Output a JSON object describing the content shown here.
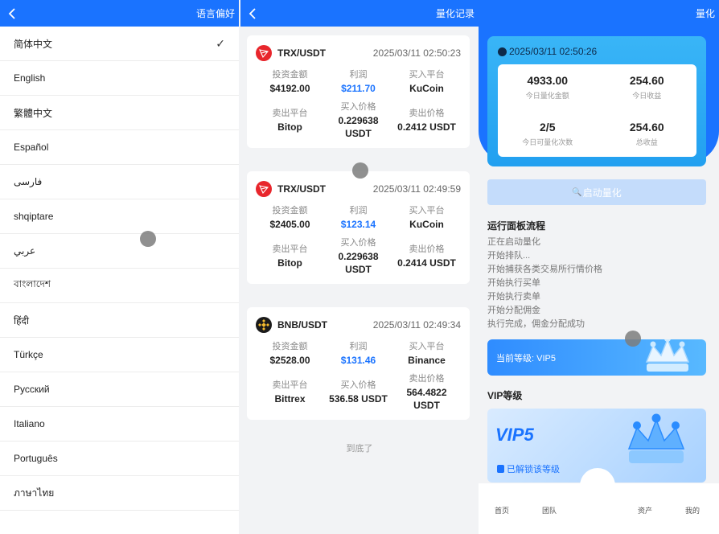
{
  "lang_panel": {
    "title": "语言偏好",
    "languages": [
      "简体中文",
      "English",
      "繁體中文",
      "Español",
      "فارسی",
      "shqiptare",
      "عربي",
      "বাংলাদেশ",
      "हिंदी",
      "Türkçe",
      "Русский",
      "Italiano",
      "Português",
      "ภาษาไทย"
    ],
    "selected_index": 0
  },
  "records_panel": {
    "title": "量化记录",
    "labels": {
      "invest": "投资金额",
      "profit": "利润",
      "buy_platform": "买入平台",
      "sell_platform": "卖出平台",
      "buy_price": "买入价格",
      "sell_price": "卖出价格"
    },
    "records": [
      {
        "coin_icon": "tron-icon",
        "pair": "TRX/USDT",
        "time": "2025/03/11 02:50:23",
        "invest": "$4192.00",
        "profit": "$211.70",
        "buy_platform": "KuCoin",
        "sell_platform": "Bitop",
        "buy_price": "0.229638 USDT",
        "sell_price": "0.2412 USDT"
      },
      {
        "coin_icon": "tron-icon",
        "pair": "TRX/USDT",
        "time": "2025/03/11 02:49:59",
        "invest": "$2405.00",
        "profit": "$123.14",
        "buy_platform": "KuCoin",
        "sell_platform": "Bitop",
        "buy_price": "0.229638 USDT",
        "sell_price": "0.2414 USDT"
      },
      {
        "coin_icon": "bnb-icon",
        "pair": "BNB/USDT",
        "time": "2025/03/11 02:49:34",
        "invest": "$2528.00",
        "profit": "$131.46",
        "buy_platform": "Binance",
        "sell_platform": "Bittrex",
        "buy_price": "536.58 USDT",
        "sell_price": "564.4822 USDT"
      }
    ],
    "end_note": "到底了"
  },
  "quant_panel": {
    "title": "量化",
    "time": "2025/03/11 02:50:26",
    "stats": [
      {
        "value": "4933.00",
        "label": "今日量化金额"
      },
      {
        "value": "254.60",
        "label": "今日收益"
      },
      {
        "value": "2/5",
        "label": "今日可量化次数"
      },
      {
        "value": "254.60",
        "label": "总收益"
      }
    ],
    "start_button": "启动量化",
    "flow_title": "运行面板流程",
    "flow_steps": [
      "正在启动量化",
      "开始排队...",
      "开始捕获各类交易所行情价格",
      "开始执行买单",
      "开始执行卖单",
      "开始分配佣金",
      "执行完成，佣金分配成功"
    ],
    "current_level": "当前等级: VIP5",
    "vip_title": "VIP等级",
    "vip_name": "VIP5",
    "vip_status": "已解锁该等级",
    "tabs": [
      "首页",
      "团队",
      "资产",
      "我的"
    ]
  },
  "colors": {
    "primary": "#1a73ff",
    "profit": "#1a73ff",
    "tron": "#e8262c",
    "bnb": "#f3ba2f"
  }
}
